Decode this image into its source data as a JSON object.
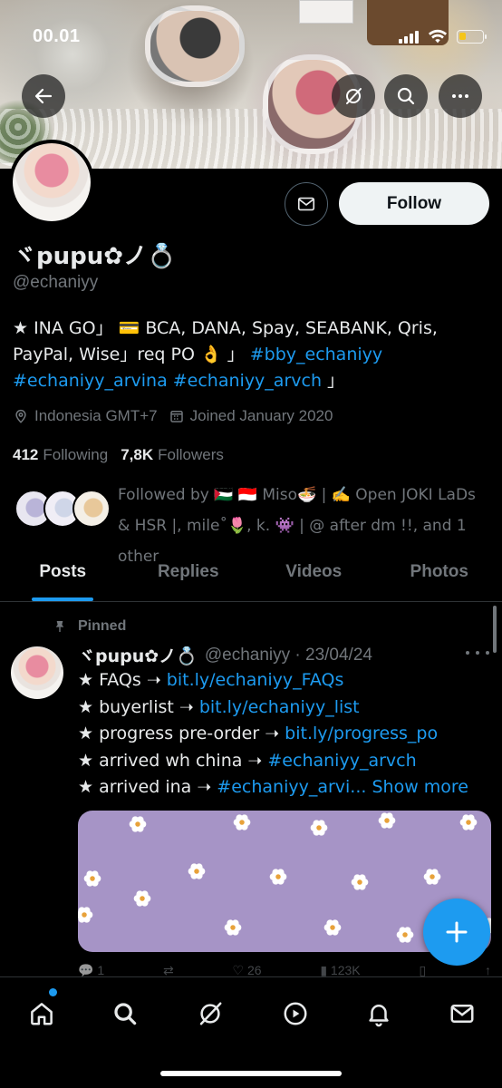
{
  "status_bar": {
    "time": "00.01"
  },
  "profile": {
    "display_name": "ヾpupu✿ノ💍",
    "handle": "@echaniyy",
    "follow_label": "Follow",
    "bio": {
      "line1": "★ INA GO」 💳 BCA, DANA, Spay, SEABANK, Qris,",
      "line2_text": "PayPal, Wise」req PO 👌 」 ",
      "line2_link": "#bby_echaniyy",
      "line3_link": "#echaniyy_arvina #echaniyy_arvch",
      "line3_text": "」"
    },
    "location": "Indonesia GMT+7",
    "joined": "Joined January 2020",
    "following_count": "412",
    "following_label": "Following",
    "followers_count": "7,8K",
    "followers_label": "Followers",
    "followed_by": "Followed by 🇵🇸 🇮🇩 Miso🍜 | ✍️ Open JOKI LaDs & HSR |, mile˚🌷, k. 👾 | @ after dm !!, and 1 other"
  },
  "tabs": [
    "Posts",
    "Replies",
    "Videos",
    "Photos"
  ],
  "pinned_post": {
    "pinned_label": "Pinned",
    "author_name": "ヾpupu✿ノ💍",
    "author_meta": "@echaniyy · 23/04/24",
    "lines": [
      {
        "text": "★ FAQs ➝ ",
        "link": "bit.ly/echaniyy_FAQs"
      },
      {
        "text": "★ buyerlist ➝ ",
        "link": "bit.ly/echaniyy_list"
      },
      {
        "text": "★ progress pre-order ➝ ",
        "link": "bit.ly/progress_po"
      },
      {
        "text": "★ arrived wh china ➝ ",
        "link": "#echaniyy_arvch"
      },
      {
        "text": "★ arrived ina ➝ ",
        "link": "#echaniyy_arvi...",
        "more": " Show more"
      }
    ],
    "actions": {
      "replies": "1",
      "reposts": "",
      "likes": "26",
      "views": "123K"
    }
  },
  "colors": {
    "accent": "#1d9bf0",
    "background": "#000000",
    "muted": "#71767b",
    "media_bg": "#a694c6"
  },
  "bottom_nav": [
    "home-icon",
    "search-icon",
    "grok-icon",
    "video-icon",
    "bell-icon",
    "mail-icon"
  ]
}
